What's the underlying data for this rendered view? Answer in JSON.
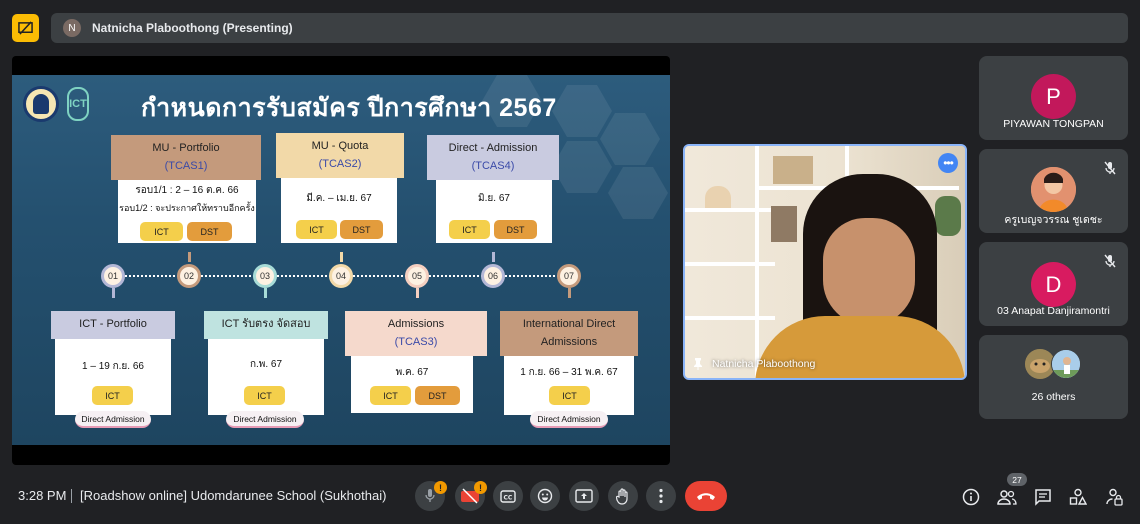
{
  "presenter_bar": {
    "avatar_initial": "N",
    "name": "Natnicha Plaboothong (Presenting)"
  },
  "slide": {
    "title": "กำหนดการรับสมัคร ปีการศึกษา 2567",
    "logo2_text": "ICT",
    "top_cards": [
      {
        "title": "MU - Portfolio",
        "code": "(TCAS1)",
        "line1": "รอบ1/1 : 2 – 16 ต.ค. 66",
        "line2": "รอบ1/2 : จะประกาศให้ทราบอีกครั้ง",
        "tag1": "ICT",
        "tag2": "DST"
      },
      {
        "title": "MU - Quota",
        "code": "(TCAS2)",
        "line1": "มี.ค. – เม.ย. 67",
        "tag1": "ICT",
        "tag2": "DST"
      },
      {
        "title": "Direct - Admission",
        "code": "(TCAS4)",
        "line1": "มิ.ย. 67",
        "tag1": "ICT",
        "tag2": "DST"
      }
    ],
    "timeline_nodes": [
      "01",
      "02",
      "03",
      "04",
      "05",
      "06",
      "07"
    ],
    "bottom_cards": [
      {
        "title": "ICT - Portfolio",
        "line1": "1 – 19 ก.ย. 66",
        "tag1": "ICT",
        "footer": "Direct Admission"
      },
      {
        "title": "ICT รับตรง จัดสอบ",
        "line1": "ก.พ. 67",
        "tag1": "ICT",
        "footer": "Direct Admission"
      },
      {
        "title": "Admissions",
        "code": "(TCAS3)",
        "line1": "พ.ค. 67",
        "tag1": "ICT",
        "tag2": "DST"
      },
      {
        "title": "International Direct",
        "title2": "Admissions",
        "line1": "1 ก.ย. 66 – 31 พ.ค. 67",
        "tag1": "ICT",
        "footer": "Direct Admission"
      }
    ]
  },
  "video": {
    "name": "Natnicha Plaboothong"
  },
  "participants": [
    {
      "initial": "P",
      "name": "PIYAWAN TONGPAN",
      "color": "#c2185b"
    },
    {
      "name": "ครูเบญจวรรณ ชูเดชะ",
      "muted": true
    },
    {
      "initial": "D",
      "name": "03 Anapat Danjiramontri",
      "color": "#d81b60",
      "muted": true
    },
    {
      "name": "26 others"
    }
  ],
  "bottom_bar": {
    "time": "3:28 PM",
    "meeting_title": "[Roadshow online] Udomdarunee School (Sukhothai)",
    "mic_badge": "!",
    "cam_badge": "!",
    "participants_count": "27"
  },
  "colors": {
    "accent": "#8ab4f8",
    "end_call": "#ea4335",
    "warning": "#f29900"
  }
}
